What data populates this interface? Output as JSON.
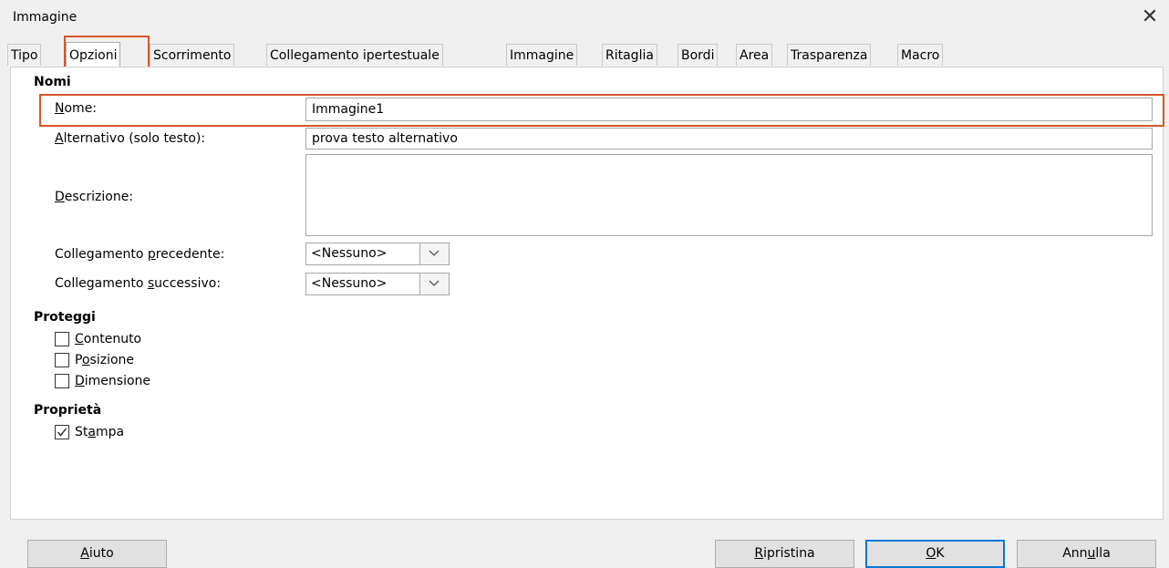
{
  "window": {
    "title": "Immagine",
    "close_symbol": "✕"
  },
  "tabs": [
    {
      "label": "Tipo"
    },
    {
      "label": "Opzioni"
    },
    {
      "label": "Scorrimento"
    },
    {
      "label": "Collegamento ipertestuale"
    },
    {
      "label": "Immagine"
    },
    {
      "label": "Ritaglia"
    },
    {
      "label": "Bordi"
    },
    {
      "label": "Area"
    },
    {
      "label": "Trasparenza"
    },
    {
      "label": "Macro"
    }
  ],
  "active_tab": "Opzioni",
  "names": {
    "heading": "Nomi",
    "name_mnemonic": "N",
    "name_rest": "ome:",
    "name_value": "Immagine1",
    "alt_mnemonic": "A",
    "alt_rest": "lternativo (solo testo):",
    "alt_value": "prova testo alternativo",
    "desc_mnemonic": "D",
    "desc_rest": "escrizione:",
    "desc_value": "",
    "prev_pre": "Collegamento ",
    "prev_mnemonic": "p",
    "prev_rest": "recedente:",
    "prev_value": "<Nessuno>",
    "next_pre": "Collegamento ",
    "next_mnemonic": "s",
    "next_rest": "uccessivo:",
    "next_value": "<Nessuno>"
  },
  "protect": {
    "heading": "Proteggi",
    "content": {
      "mnemonic": "C",
      "rest": "ontenuto",
      "checked": false
    },
    "position": {
      "pre": "P",
      "mnemonic": "o",
      "rest": "sizione",
      "checked": false
    },
    "size": {
      "mnemonic": "D",
      "rest": "imensione",
      "checked": false
    }
  },
  "properties": {
    "heading": "Proprietà",
    "print": {
      "pre": "St",
      "mnemonic": "a",
      "rest": "mpa",
      "checked": true
    }
  },
  "buttons": {
    "help": {
      "mnemonic": "A",
      "rest": "iuto"
    },
    "reset": {
      "mnemonic": "R",
      "rest": "ipristina"
    },
    "ok": {
      "mnemonic": "O",
      "rest": "K"
    },
    "cancel": {
      "pre": "Ann",
      "mnemonic": "u",
      "rest": "lla"
    }
  },
  "colors": {
    "highlight": "#d9542b",
    "default_button_border": "#0078d7",
    "panel_bg": "#ffffff",
    "window_bg": "#f0f0f0"
  }
}
